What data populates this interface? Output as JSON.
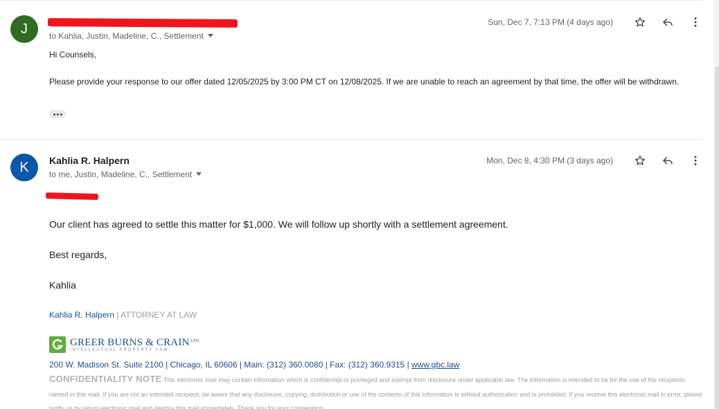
{
  "messages": [
    {
      "avatar_letter": "J",
      "avatar_color": "#2e6b23",
      "to_line": "to Kahlia, Justin, Madeline, C., Settlement",
      "date": "Sun, Dec 7, 7:13 PM (4 days ago)",
      "greeting": "Hi Counsels,",
      "body": "Please provide your response to our offer dated 12/05/2025 by 3:00 PM CT on 12/08/2025. If we are unable to reach an agreement by that time, the offer will be withdrawn."
    },
    {
      "avatar_letter": "K",
      "avatar_color": "#0b57a8",
      "sender": "Kahlia R. Halpern",
      "to_line": "to me, Justin, Madeline, C., Settlement",
      "date": "Mon, Dec 8, 4:30 PM (3 days ago)",
      "body": "Our client has agreed to settle this matter for $1,000. We will follow up shortly with a settlement agreement.",
      "closing": "Best regards,",
      "sign_off": "Kahlia",
      "signature": {
        "name": "Kahlia R. Halpern",
        "title": " | ATTORNEY AT LAW",
        "firm_logo_main": "GREER BURNS & CRAIN",
        "firm_logo_suffix": "LTD",
        "firm_logo_sub": "INTELLECTUAL PROPERTY LAW",
        "address": "200 W. Madison St. Suite 2100 | Chicago, IL 60606 | Main: (312) 360.0080 | Fax: (312) 360.9315 | ",
        "website": "www.gbc.law",
        "confidentiality_label": "CONFIDENTIALITY NOTE",
        "confidentiality_text": " This electronic mail may contain information which is confidential or privileged and exempt from disclosure under applicable law. The information is intended to be for the use of the recipients named in this mail. If you are not an intended recipient, be aware that any disclosure, copying, distribution or use of the contents of this information is without authorization and is prohibited. If you receive this electronic mail in error, please notify us by return electronic mail and destroy this mail immediately. Thank you for your cooperation."
      }
    }
  ],
  "icons": [
    "star-icon",
    "reply-icon",
    "more-vert-icon"
  ],
  "colors": {
    "redaction": "#f0151b",
    "link": "#1a4f8b",
    "muted": "#5f6368"
  }
}
